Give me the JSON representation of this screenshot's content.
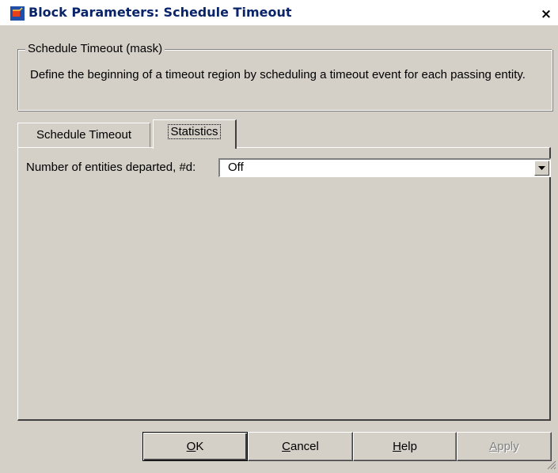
{
  "window": {
    "title": "Block Parameters: Schedule Timeout",
    "close_label": "×"
  },
  "group": {
    "legend": "Schedule Timeout (mask)",
    "description": "Define the beginning of a timeout region by scheduling a timeout event for each passing entity."
  },
  "tabs": [
    {
      "label": "Schedule Timeout",
      "active": false
    },
    {
      "label": "Statistics",
      "active": true
    }
  ],
  "fields": {
    "entities_departed": {
      "label": "Number of entities departed, #d:",
      "value": "Off"
    }
  },
  "buttons": {
    "ok": {
      "mnemonic": "O",
      "rest": "K"
    },
    "cancel": {
      "mnemonic": "C",
      "rest": "ancel"
    },
    "help": {
      "mnemonic": "H",
      "rest": "elp"
    },
    "apply": {
      "mnemonic": "A",
      "rest": "pply",
      "enabled": false
    }
  },
  "icons": {
    "app": "simulink-block-icon",
    "close": "close-icon",
    "dropdown": "chevron-down-icon"
  },
  "colors": {
    "title_text": "#0a246a",
    "dialog_bg": "#d4d0c8",
    "disabled_text": "#808080"
  }
}
